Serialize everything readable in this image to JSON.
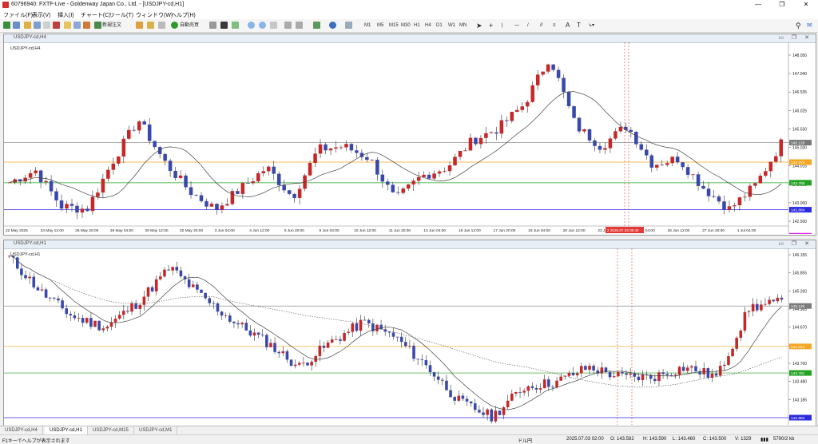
{
  "app": {
    "title": "60796940: FXTF-Live - Goldenway Japan Co., Ltd. - [USDJPY-cd,H1]",
    "win_buttons": [
      "—",
      "❐",
      "✕"
    ]
  },
  "menu": [
    "ファイル(F)",
    "表示(V)",
    "挿入(I)",
    "チャート(C)",
    "ツール(T)",
    "ウィンドウ(W)",
    "ヘルプ(H)"
  ],
  "toolbar": {
    "new_order": "新規注文",
    "auto_trade": "自動売買",
    "timeframes": [
      "M1",
      "M5",
      "M15",
      "M30",
      "H1",
      "H4",
      "D1",
      "W1",
      "MN"
    ]
  },
  "chart_top": {
    "window_title": "USDJPY-cd,H4",
    "symbol_label": "USDJPY-cd,H4",
    "price_ticks": [
      "148.050",
      "147.040",
      "146.535",
      "146.025",
      "145.530",
      "145.030",
      "144.015",
      "143.505",
      "143.000",
      "142.500"
    ],
    "hlines": {
      "current": {
        "price": "145.126",
        "color": "#7a7a7a"
      },
      "orange": {
        "price": "144.474",
        "color": "#f5a623"
      },
      "green": {
        "price": "143.785",
        "color": "#22a322"
      },
      "blue": {
        "price": "142.884",
        "color": "#2a2ae0"
      },
      "magenta": {
        "price": "142.013",
        "color": "#e020e0"
      }
    },
    "time_labels": [
      "22 May 2025",
      "23 May 12:00",
      "26 May 20:00",
      "28 May 04:00",
      "29 May 12:00",
      "30 May 20:00",
      "3 Jun 04:00",
      "4 Jun 12:00",
      "5 Jun 20:00",
      "9 Jun 04:00",
      "10 Jun 12:00",
      "11 Jun 20:00",
      "13 Jun 04:00",
      "16 Jun 12:00",
      "17 Jun 20:00",
      "19 Jun 04:00",
      "20 Jun 12:00",
      "23 Jun 20:00",
      "25 Jun 04:00",
      "26 Jun 12:00",
      "27 Jun 20:00",
      "1 Jul 04:00"
    ],
    "time_marker": "2 2025.07.03 08:40"
  },
  "chart_bottom": {
    "window_title": "USDJPY-cd,H1",
    "symbol_label": "USDJPY-cd,H1",
    "price_ticks": [
      "146.155",
      "145.855",
      "145.260",
      "144.965",
      "144.670",
      "144.075",
      "143.700",
      "143.480",
      "143.185",
      "142.884"
    ],
    "hlines": {
      "current": {
        "price": "145.126",
        "color": "#7a7a7a"
      },
      "orange": {
        "price": "144.314",
        "color": "#f5a623"
      },
      "green": {
        "price": "143.781",
        "color": "#22a322"
      },
      "blue": {
        "price": "142.884",
        "color": "#2a2ae0"
      }
    }
  },
  "tabs": [
    "USDJPY-cd,H4",
    "USDJPY-cd,H1",
    "USDJPY-cd,M15",
    "USDJPY-cd,M1"
  ],
  "status": {
    "help": "F1キーでヘルプが表示されます",
    "symbol": "ドル円",
    "time": "2025.07.03 02:00",
    "open": "O: 143.582",
    "high": "H: 143.590",
    "low": "L: 143.460",
    "close": "C: 143.500",
    "volume": "V: 1329",
    "traffic": "5790/2 kb"
  }
}
